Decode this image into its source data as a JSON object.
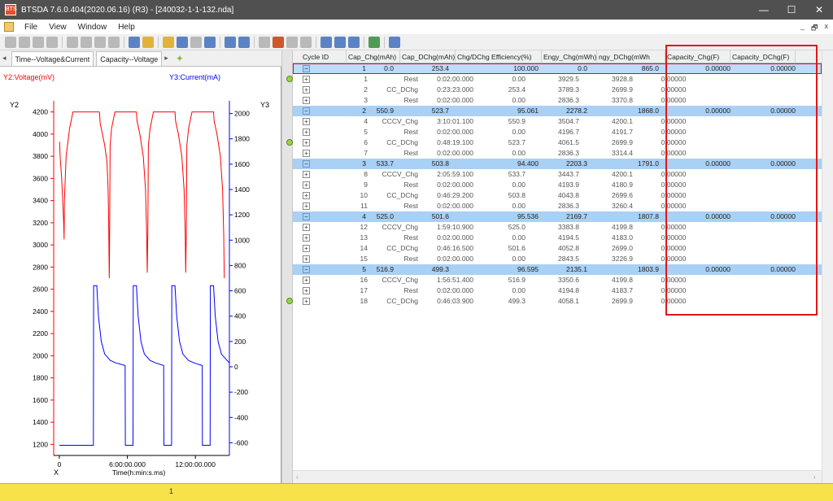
{
  "window": {
    "title": "BTSDA 7.6.0.404(2020.06.16) (R3) - [240032-1-1-132.nda]",
    "app_icon_text": "BTS",
    "minimize": "—",
    "maximize": "☐",
    "close": "✕"
  },
  "menu": [
    "File",
    "View",
    "Window",
    "Help"
  ],
  "mdi_controls": [
    "_",
    "🗗",
    "x"
  ],
  "tabs": [
    "Time--Voltage&Current",
    "Capacity--Voltage"
  ],
  "tab_arrows": {
    "left": "◂",
    "right": "▸"
  },
  "colors": {
    "voltage": "#ff0000",
    "current": "#0000ff",
    "cycle_row": "#a9d0f5",
    "highlight": "#e01818",
    "status": "#f7e24a"
  },
  "chart_data": {
    "type": "line",
    "y2_label": "Y2:Voltage(mV)",
    "y3_label": "Y3:Current(mA)",
    "y2_axis_name": "Y2",
    "y3_axis_name": "Y3",
    "x_axis_name": "X",
    "xlabel": "Time(h:min:s.ms)",
    "x_ticks": [
      "0",
      "6:00:00.000",
      "12:00:00.000"
    ],
    "y2_ticks": [
      4200,
      4000,
      3800,
      3600,
      3400,
      3200,
      3000,
      2800,
      2600,
      2400,
      2200,
      2000,
      1800,
      1600,
      1400,
      1200
    ],
    "y3_ticks": [
      2000,
      1800,
      1600,
      1400,
      1200,
      1000,
      800,
      600,
      400,
      200,
      0,
      -200,
      -400,
      -600
    ],
    "y2_range": [
      1100,
      4300
    ],
    "y3_range": [
      -700,
      2100
    ],
    "x_range_h": [
      -0.5,
      15
    ],
    "series": [
      {
        "name": "Voltage(mV)",
        "axis": "y2",
        "points": [
          [
            0,
            3930
          ],
          [
            0.02,
            3929
          ],
          [
            0.07,
            3800
          ],
          [
            0.2,
            3600
          ],
          [
            0.3,
            3400
          ],
          [
            0.38,
            3200
          ],
          [
            0.42,
            3050
          ],
          [
            0.45,
            3400
          ],
          [
            0.6,
            3800
          ],
          [
            0.9,
            4050
          ],
          [
            1.2,
            4200
          ],
          [
            3.5,
            4200
          ],
          [
            3.55,
            4195
          ],
          [
            3.6,
            4100
          ],
          [
            3.8,
            4000
          ],
          [
            4.0,
            3900
          ],
          [
            4.2,
            3750
          ],
          [
            4.3,
            3500
          ],
          [
            4.35,
            3200
          ],
          [
            4.4,
            2700
          ],
          [
            4.42,
            2900
          ],
          [
            4.48,
            3900
          ],
          [
            4.6,
            4050
          ],
          [
            4.9,
            4200
          ],
          [
            6.8,
            4200
          ],
          [
            6.85,
            4120
          ],
          [
            7.1,
            4000
          ],
          [
            7.4,
            3800
          ],
          [
            7.6,
            3500
          ],
          [
            7.7,
            3100
          ],
          [
            7.75,
            2750
          ],
          [
            7.8,
            3100
          ],
          [
            7.85,
            3900
          ],
          [
            8.0,
            4050
          ],
          [
            8.3,
            4200
          ],
          [
            10.2,
            4200
          ],
          [
            10.25,
            4120
          ],
          [
            10.5,
            4000
          ],
          [
            10.8,
            3800
          ],
          [
            11.0,
            3500
          ],
          [
            11.1,
            3100
          ],
          [
            11.15,
            2750
          ],
          [
            11.2,
            3100
          ],
          [
            11.25,
            3900
          ],
          [
            11.4,
            4050
          ],
          [
            11.7,
            4200
          ],
          [
            13.6,
            4200
          ],
          [
            13.65,
            4120
          ],
          [
            13.9,
            4000
          ],
          [
            14.2,
            3800
          ],
          [
            14.4,
            3500
          ],
          [
            14.5,
            3100
          ],
          [
            14.55,
            2700
          ]
        ]
      },
      {
        "name": "Current(mA)",
        "axis": "y3",
        "points": [
          [
            0,
            -620
          ],
          [
            3.0,
            -620
          ],
          [
            3.02,
            640
          ],
          [
            3.3,
            640
          ],
          [
            3.45,
            400
          ],
          [
            3.7,
            200
          ],
          [
            4.0,
            100
          ],
          [
            4.5,
            50
          ],
          [
            5.0,
            30
          ],
          [
            5.8,
            10
          ],
          [
            5.82,
            -620
          ],
          [
            6.5,
            -620
          ],
          [
            6.52,
            640
          ],
          [
            6.8,
            640
          ],
          [
            6.95,
            400
          ],
          [
            7.2,
            200
          ],
          [
            7.5,
            100
          ],
          [
            8.0,
            50
          ],
          [
            8.5,
            30
          ],
          [
            9.2,
            10
          ],
          [
            9.22,
            -620
          ],
          [
            9.9,
            -620
          ],
          [
            9.92,
            640
          ],
          [
            10.2,
            640
          ],
          [
            10.35,
            400
          ],
          [
            10.6,
            200
          ],
          [
            10.9,
            100
          ],
          [
            11.4,
            50
          ],
          [
            11.9,
            30
          ],
          [
            12.6,
            10
          ],
          [
            12.62,
            -620
          ],
          [
            13.3,
            -620
          ],
          [
            13.32,
            640
          ],
          [
            13.6,
            640
          ],
          [
            13.75,
            400
          ],
          [
            14.0,
            200
          ],
          [
            14.3,
            100
          ],
          [
            14.8,
            50
          ],
          [
            15.0,
            30
          ]
        ]
      }
    ]
  },
  "table": {
    "columns": [
      "Cycle ID",
      "Cap_Chg(mAh)",
      "Cap_DChg(mAh)",
      "Chg/DChg Efficiency(%)",
      "Engy_Chg(mWh)",
      "ngy_DChg(mWh",
      "Capacity_Chg(F)",
      "Capacity_DChg(F)"
    ],
    "rows": [
      {
        "kind": "cycle",
        "cells": [
          "1",
          "0.0",
          "253.4",
          "100.000",
          "0.0",
          "865.0",
          "0.00000",
          "0.00000"
        ]
      },
      {
        "kind": "step",
        "cells": [
          "1",
          "Rest",
          "0:02:00.000",
          "0.00",
          "3929.5",
          "3928.8",
          "0.00000"
        ],
        "bulb": true
      },
      {
        "kind": "step",
        "cells": [
          "2",
          "CC_DChg",
          "0:23:23.000",
          "253.4",
          "3789.3",
          "2699.9",
          "0.00000"
        ]
      },
      {
        "kind": "step",
        "cells": [
          "3",
          "Rest",
          "0:02:00.000",
          "0.00",
          "2836.3",
          "3370.8",
          "0.00000"
        ]
      },
      {
        "kind": "cycle",
        "cells": [
          "2",
          "550.9",
          "523.7",
          "95.061",
          "2278.2",
          "1868.0",
          "0.00000",
          "0.00000"
        ]
      },
      {
        "kind": "step",
        "cells": [
          "4",
          "CCCV_Chg",
          "3:10:01.100",
          "550.9",
          "3504.7",
          "4200.1",
          "0.00000"
        ]
      },
      {
        "kind": "step",
        "cells": [
          "5",
          "Rest",
          "0:02:00.000",
          "0.00",
          "4196.7",
          "4191.7",
          "0.00000"
        ]
      },
      {
        "kind": "step",
        "cells": [
          "6",
          "CC_DChg",
          "0:48:19.100",
          "523.7",
          "4061.5",
          "2699.9",
          "0.00000"
        ],
        "bulb": true
      },
      {
        "kind": "step",
        "cells": [
          "7",
          "Rest",
          "0:02:00.000",
          "0.00",
          "2836.3",
          "3314.4",
          "0.00000"
        ]
      },
      {
        "kind": "cycle",
        "cells": [
          "3",
          "533.7",
          "503.8",
          "94.400",
          "2203.3",
          "1791.0",
          "0.00000",
          "0.00000"
        ]
      },
      {
        "kind": "step",
        "cells": [
          "8",
          "CCCV_Chg",
          "2:05:59.100",
          "533.7",
          "3443.7",
          "4200.1",
          "0.00000"
        ]
      },
      {
        "kind": "step",
        "cells": [
          "9",
          "Rest",
          "0:02:00.000",
          "0.00",
          "4193.9",
          "4180.9",
          "0.00000"
        ]
      },
      {
        "kind": "step",
        "cells": [
          "10",
          "CC_DChg",
          "0:46:29.200",
          "503.8",
          "4043.8",
          "2699.6",
          "0.00000"
        ]
      },
      {
        "kind": "step",
        "cells": [
          "11",
          "Rest",
          "0:02:00.000",
          "0.00",
          "2836.3",
          "3260.4",
          "0.00000"
        ]
      },
      {
        "kind": "cycle",
        "cells": [
          "4",
          "525.0",
          "501.6",
          "95.536",
          "2169.7",
          "1807.8",
          "0.00000",
          "0.00000"
        ]
      },
      {
        "kind": "step",
        "cells": [
          "12",
          "CCCV_Chg",
          "1:59:10.900",
          "525.0",
          "3383.8",
          "4199.8",
          "0.00000"
        ]
      },
      {
        "kind": "step",
        "cells": [
          "13",
          "Rest",
          "0:02:00.000",
          "0.00",
          "4194.5",
          "4183.0",
          "0.00000"
        ]
      },
      {
        "kind": "step",
        "cells": [
          "14",
          "CC_DChg",
          "0:46:16.500",
          "501.6",
          "4052.8",
          "2699.0",
          "0.00000"
        ]
      },
      {
        "kind": "step",
        "cells": [
          "15",
          "Rest",
          "0:02:00.000",
          "0.00",
          "2843.5",
          "3226.9",
          "0.00000"
        ]
      },
      {
        "kind": "cycle",
        "cells": [
          "5",
          "516.9",
          "499.3",
          "96.595",
          "2135.1",
          "1803.9",
          "0.00000",
          "0.00000"
        ]
      },
      {
        "kind": "step",
        "cells": [
          "16",
          "CCCV_Chg",
          "1:56:51.400",
          "516.9",
          "3350.6",
          "4199.8",
          "0.00000"
        ]
      },
      {
        "kind": "step",
        "cells": [
          "17",
          "Rest",
          "0:02:00.000",
          "0.00",
          "4194.8",
          "4183.7",
          "0.00000"
        ]
      },
      {
        "kind": "step",
        "cells": [
          "18",
          "CC_DChg",
          "0:46:03.900",
          "499.3",
          "4058.1",
          "2699.9",
          "0.00000"
        ],
        "bulb": true
      }
    ]
  },
  "status": {
    "text": "1"
  }
}
